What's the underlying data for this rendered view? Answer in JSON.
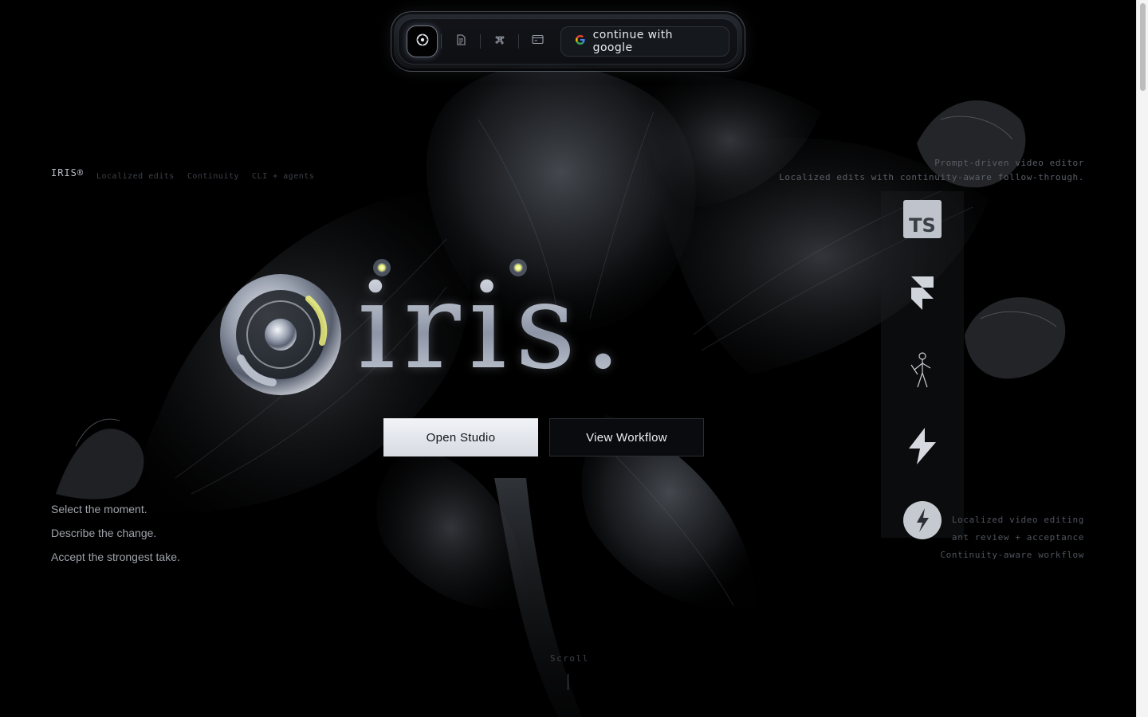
{
  "nav": {
    "icons": [
      "iris-logo-icon",
      "document-icon",
      "command-icon",
      "card-icon"
    ],
    "google_label": "continue with google"
  },
  "brand": "IRIS®",
  "tags": [
    "Localized edits",
    "Continuity",
    "CLI + agents"
  ],
  "right_top": {
    "line1": "Prompt-driven video editor",
    "line2": "Localized edits with continuity-aware follow-through."
  },
  "hero": {
    "wordmark": "iris."
  },
  "cta": {
    "primary": "Open Studio",
    "secondary": "View Workflow"
  },
  "steps": [
    "Select the moment.",
    "Describe the change.",
    "Accept the strongest take."
  ],
  "right_bottom": [
    "Localized video editing",
    "ant review + acceptance",
    "Continuity-aware workflow"
  ],
  "tools": [
    "typescript-icon",
    "framer-icon",
    "figure-icon",
    "lightning-icon",
    "fal-icon"
  ],
  "scroll_label": "Scroll",
  "colors": {
    "background": "#000000",
    "accent": "#e8f07a",
    "chrome": "#c3c8d3"
  }
}
